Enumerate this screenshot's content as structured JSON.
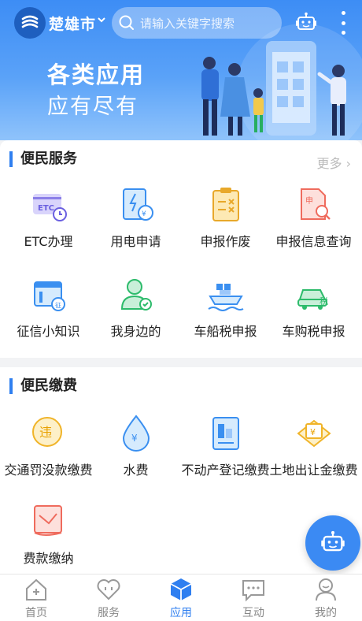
{
  "header": {
    "city": "楚雄市",
    "search_placeholder": "请输入关键字搜索",
    "slogan_line1": "各类应用",
    "slogan_line2": "应有尽有"
  },
  "convenience_services": {
    "title": "便民服务",
    "more": "更多",
    "items": [
      {
        "label": "ETC办理",
        "icon": "etc-card-icon"
      },
      {
        "label": "用电申请",
        "icon": "electric-application-icon"
      },
      {
        "label": "申报作废",
        "icon": "declaration-cancel-icon"
      },
      {
        "label": "申报信息查询",
        "icon": "declaration-query-icon"
      },
      {
        "label": "征信小知识",
        "icon": "credit-knowledge-icon"
      },
      {
        "label": "我身边的",
        "icon": "nearby-person-icon"
      },
      {
        "label": "车船税申报",
        "icon": "vessel-tax-icon"
      },
      {
        "label": "车购税申报",
        "icon": "car-purchase-tax-icon"
      }
    ]
  },
  "convenience_payments": {
    "title": "便民缴费",
    "items": [
      {
        "label": "交通罚没款缴费",
        "icon": "traffic-fine-icon"
      },
      {
        "label": "水费",
        "icon": "water-fee-icon"
      },
      {
        "label": "不动产登记缴费",
        "icon": "real-estate-fee-icon"
      },
      {
        "label": "土地出让金缴费",
        "icon": "land-fee-icon"
      },
      {
        "label": "费款缴纳",
        "icon": "fee-payment-icon"
      }
    ]
  },
  "bottom_nav": [
    {
      "label": "首页",
      "icon": "home-icon",
      "active": false
    },
    {
      "label": "服务",
      "icon": "heart-service-icon",
      "active": false
    },
    {
      "label": "应用",
      "icon": "cube-app-icon",
      "active": true
    },
    {
      "label": "互动",
      "icon": "chat-icon",
      "active": false
    },
    {
      "label": "我的",
      "icon": "user-icon",
      "active": false
    }
  ],
  "colors": {
    "accent": "#2f7ff0",
    "banner": "#3d8df5"
  }
}
